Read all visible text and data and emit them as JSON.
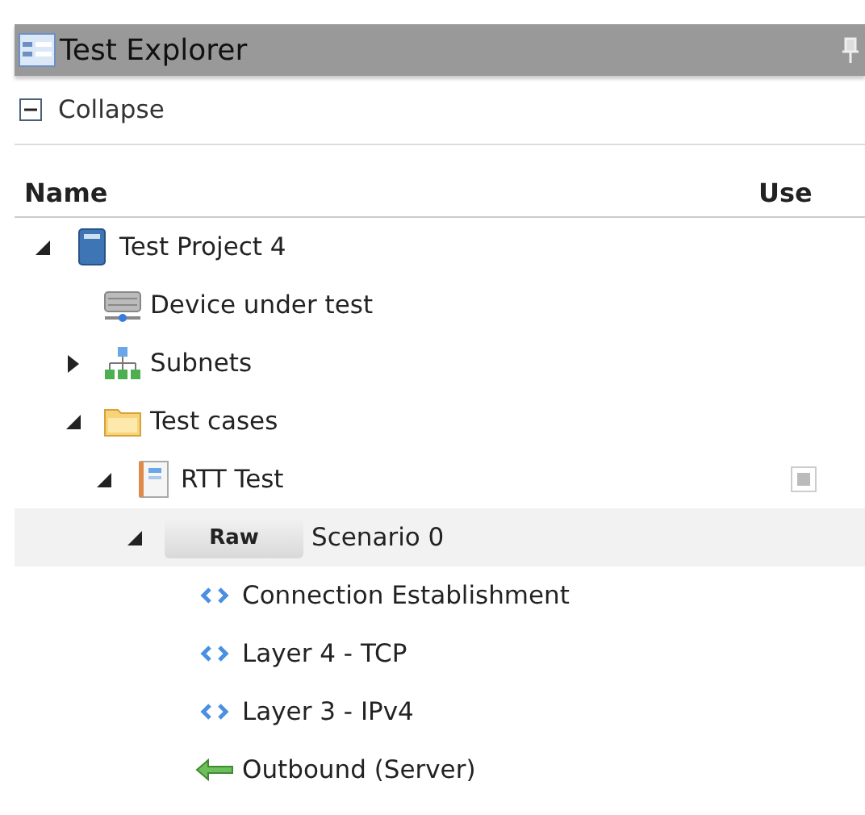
{
  "window": {
    "title": "Test Explorer"
  },
  "toolbar": {
    "collapse_label": "Collapse"
  },
  "columns": [
    "Name",
    "Use"
  ],
  "tree": [
    {
      "label": "Test Project 4",
      "kind": "project",
      "expanded": true,
      "selected": false,
      "children": [
        {
          "label": "Device under test",
          "kind": "device",
          "selected": false
        },
        {
          "label": "Subnets",
          "kind": "subnets",
          "expanded": false,
          "selected": false
        },
        {
          "label": "Test cases",
          "kind": "folder",
          "expanded": true,
          "selected": false,
          "children": [
            {
              "label": "RTT Test",
              "kind": "test",
              "expanded": true,
              "selected": false,
              "use": {
                "checked": false,
                "indeterminate": true
              },
              "children": [
                {
                  "label": "Scenario 0",
                  "kind": "scenario",
                  "badge": "Raw",
                  "expanded": true,
                  "selected": true,
                  "children": [
                    {
                      "label": "Connection Establishment",
                      "kind": "layer",
                      "selected": false
                    },
                    {
                      "label": "Layer 4 - TCP",
                      "kind": "layer",
                      "selected": false
                    },
                    {
                      "label": "Layer 3 - IPv4",
                      "kind": "layer",
                      "selected": false
                    },
                    {
                      "label": "Outbound (Server)",
                      "kind": "outbound",
                      "selected": false
                    }
                  ]
                }
              ]
            }
          ]
        }
      ]
    }
  ]
}
